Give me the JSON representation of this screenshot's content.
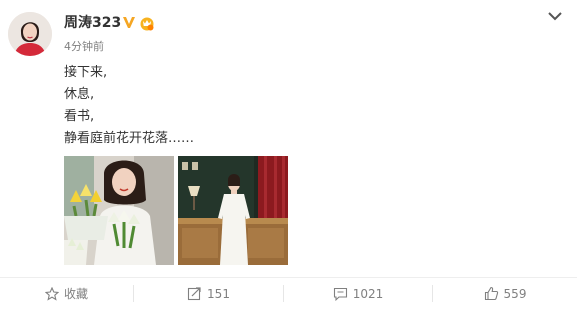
{
  "post": {
    "username": "周涛323",
    "timestamp": "4分钟前",
    "lines": [
      "接下来,",
      "休息,",
      "看书,",
      "静看庭前花开花落……"
    ],
    "badges": {
      "verified": "verified-v-badge",
      "member": "member-crown-badge"
    },
    "images": [
      {
        "icon": "photo-woman-with-tulips"
      },
      {
        "icon": "photo-woman-in-white-dress"
      }
    ]
  },
  "actions": {
    "favorite_label": "收藏",
    "repost_count": "151",
    "comment_count": "1021",
    "like_count": "559"
  },
  "colors": {
    "text": "#333333",
    "muted": "#808080",
    "verified": "#f5a623",
    "divider": "#eeeeee"
  }
}
